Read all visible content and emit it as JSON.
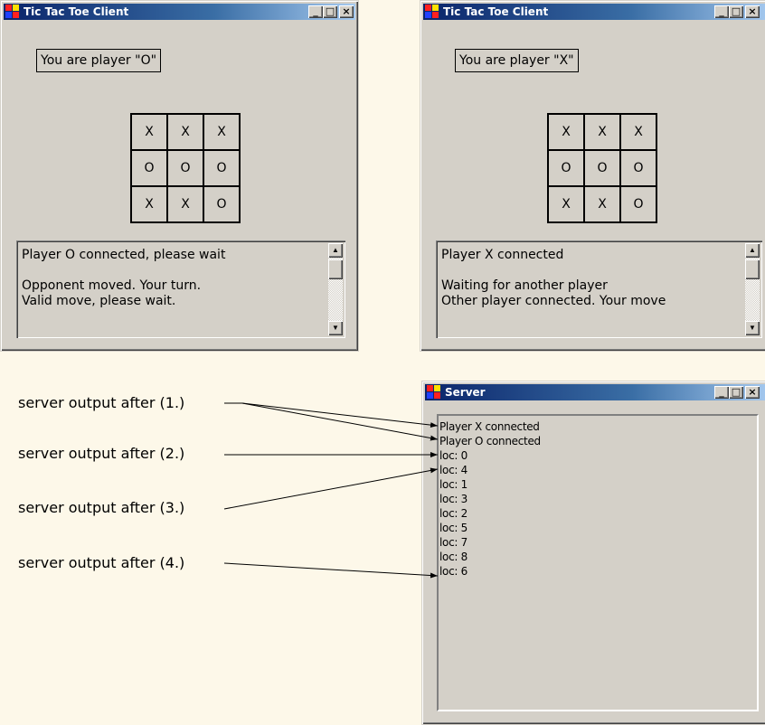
{
  "client_o": {
    "title": "Tic Tac Toe Client",
    "player_label": "You are player \"O\"",
    "board": [
      "X",
      "X",
      "X",
      "O",
      "O",
      "O",
      "X",
      "X",
      "O"
    ],
    "messages": [
      "Player O connected, please wait",
      "",
      "Opponent moved. Your turn.",
      "Valid move, please wait."
    ]
  },
  "client_x": {
    "title": "Tic Tac Toe Client",
    "player_label": "You are player \"X\"",
    "board": [
      "X",
      "X",
      "X",
      "O",
      "O",
      "O",
      "X",
      "X",
      "O"
    ],
    "messages": [
      "Player X connected",
      "",
      "Waiting for another player",
      "Other player connected. Your move"
    ]
  },
  "server": {
    "title": "Server",
    "log": [
      "Player X connected",
      "Player O connected",
      "loc: 0",
      "loc: 4",
      "loc: 1",
      "loc: 3",
      "loc: 2",
      "loc: 5",
      "loc: 7",
      "loc: 8",
      "loc: 6"
    ]
  },
  "annotations": [
    "server output after (1.)",
    "server output after (2.)",
    "server output after (3.)",
    "server output after (4.)"
  ],
  "window_buttons": {
    "minimize": "_",
    "maximize": "□",
    "close": "×"
  },
  "scroll_arrows": {
    "up": "▲",
    "down": "▼"
  },
  "colors": {
    "background": "#fdf8e9",
    "window": "#d4d0c8",
    "titlebar_start": "#0a246a",
    "titlebar_end": "#a6caf0"
  }
}
